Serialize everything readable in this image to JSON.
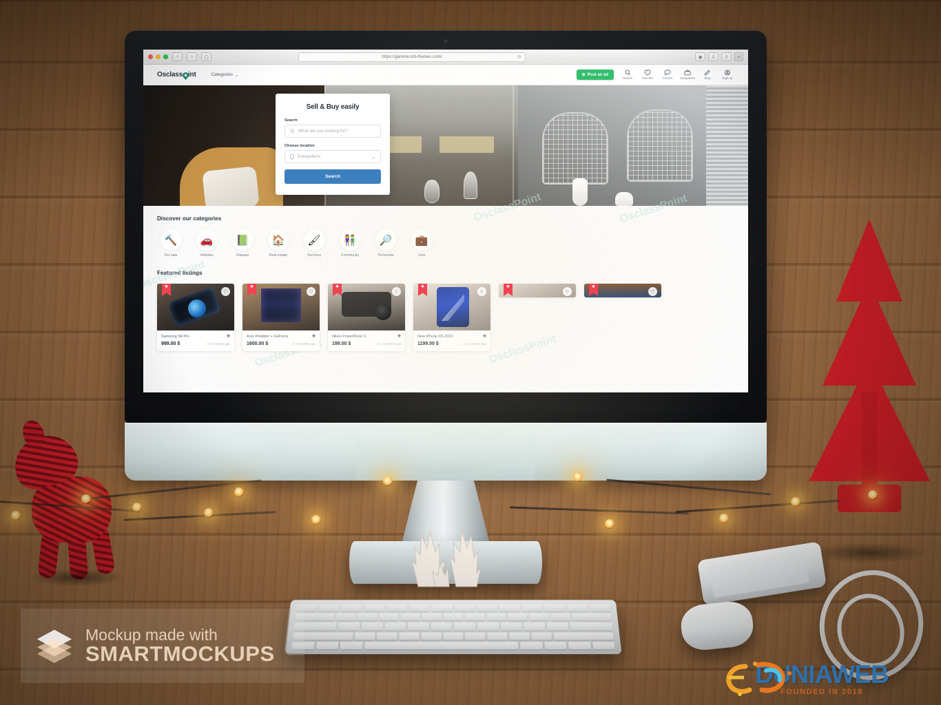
{
  "browser": {
    "url": "https://gamma.mb-themes.com/",
    "reload_icon": "reload-icon",
    "back_icon": "‹",
    "forward_icon": "›",
    "sidebar_icon": "▢",
    "tab_plus": "+",
    "toolbar_icons": [
      "shield-icon",
      "download-icon",
      "share-icon"
    ]
  },
  "site": {
    "logo": {
      "pre": "Osclass",
      "post": "int",
      "pin": "location-pin-icon"
    },
    "nav": {
      "categories": "Categories",
      "caret": "⌄"
    },
    "post_ad": "Post an ad",
    "icons": [
      {
        "name": "search-icon",
        "glyph": "⌕",
        "label": "Search"
      },
      {
        "name": "favorite-icon",
        "glyph": "♡",
        "label": "Favorite"
      },
      {
        "name": "forums-icon",
        "glyph": "◯",
        "label": "Forums"
      },
      {
        "name": "companies-icon",
        "glyph": "▣",
        "label": "Companies"
      },
      {
        "name": "blog-icon",
        "glyph": "✎",
        "label": "Blog"
      },
      {
        "name": "signup-icon",
        "glyph": "◉",
        "label": "Sign up"
      }
    ]
  },
  "hero": {
    "card": {
      "title": "Sell & Buy easily",
      "search_label": "Search",
      "search_placeholder": "What are you looking for?",
      "location_label": "Choose location",
      "location_value": "Everywhere",
      "button": "Search",
      "button_color": "#3c7fbf"
    }
  },
  "categories_section": {
    "title": "Discover our categories",
    "items": [
      {
        "label": "For sale",
        "emoji": "🔨",
        "icon": "for-sale-icon"
      },
      {
        "label": "Vehicles",
        "emoji": "🚗",
        "icon": "vehicles-icon"
      },
      {
        "label": "Classes",
        "emoji": "📗",
        "icon": "classes-icon"
      },
      {
        "label": "Real estate",
        "emoji": "🏠",
        "icon": "real-estate-icon"
      },
      {
        "label": "Services",
        "emoji": "🖌",
        "icon": "services-icon"
      },
      {
        "label": "Community",
        "emoji": "👫",
        "icon": "community-icon"
      },
      {
        "label": "Personals",
        "emoji": "🔎",
        "icon": "personals-icon"
      },
      {
        "label": "Jobs",
        "emoji": "💼",
        "icon": "jobs-icon"
      }
    ]
  },
  "featured": {
    "title": "Featured listings",
    "badge_icon": "★",
    "fav_icon": "♡",
    "expand_icon": "✥",
    "clock_icon": "◷",
    "listings": [
      {
        "title": "Samsung S8 Pro",
        "price": "999.00 $",
        "ago": "6 months ago",
        "photo": "ph-phone"
      },
      {
        "title": "Acer Predator + GeForce",
        "price": "1600.00 $",
        "ago": "6 months ago",
        "photo": "ph-pc"
      },
      {
        "title": "Nikon PowerShow S",
        "price": "199.00 $",
        "ago": "6 months ago",
        "photo": "ph-cam"
      },
      {
        "title": "New iPhone XS 2019",
        "price": "1199.00 $",
        "ago": "6 months ago",
        "photo": "ph-s7"
      }
    ],
    "partial_row": [
      {
        "photo": "ph-gray"
      },
      {
        "photo": "ph-night"
      }
    ]
  },
  "watermarks": {
    "page": "OsclassPoint",
    "smartmockups_line1": "Mockup made with",
    "smartmockups_line2": "SMARTMOCKUPS",
    "dunia_main": "DUNIAWEB",
    "dunia_sub": "FOUNDED IN 2018"
  },
  "colors": {
    "accent_green": "#2ebd6b",
    "accent_blue": "#3c7fbf",
    "badge_red": "#ef4452",
    "logo_teal": "#2f8f80"
  }
}
